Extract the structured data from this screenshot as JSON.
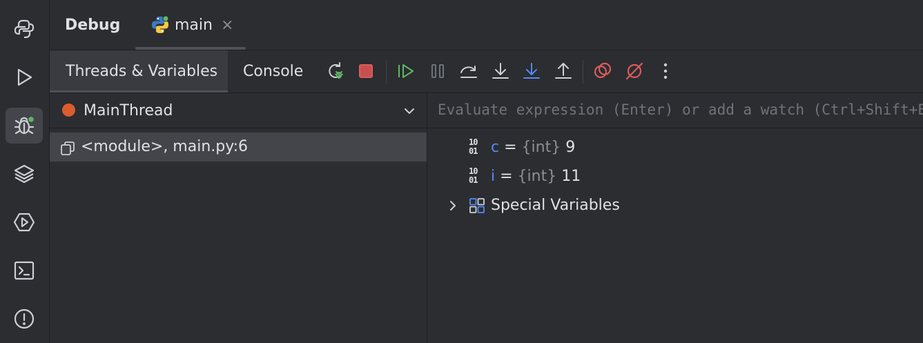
{
  "sidebar": {
    "items": [
      {
        "icon": "python-packages-icon"
      },
      {
        "icon": "run-icon"
      },
      {
        "icon": "debug-icon",
        "active": true
      },
      {
        "icon": "layers-icon"
      },
      {
        "icon": "services-icon"
      },
      {
        "icon": "terminal-icon"
      },
      {
        "icon": "problems-icon"
      }
    ]
  },
  "header": {
    "title": "Debug",
    "tab_label": "main",
    "tab_close": "×"
  },
  "toolbar": {
    "tabs": [
      "Threads & Variables",
      "Console"
    ],
    "buttons": [
      "rerun-icon",
      "stop-icon",
      "resume-icon",
      "pause-icon",
      "step-over-icon",
      "step-into-icon",
      "step-into-my-code-icon",
      "step-out-icon",
      "view-breakpoints-icon",
      "mute-breakpoints-icon",
      "more-icon"
    ]
  },
  "threads": {
    "selected": "MainThread",
    "frames": [
      {
        "label": "<module>, main.py:6"
      }
    ]
  },
  "variables": {
    "placeholder": "Evaluate expression (Enter) or add a watch (Ctrl+Shift+Enter)",
    "items": [
      {
        "name": "c",
        "eq": " = ",
        "type": "{int}",
        "value": " 9"
      },
      {
        "name": "i",
        "eq": " = ",
        "type": "{int}",
        "value": " 11"
      }
    ],
    "special": "Special Variables"
  },
  "colors": {
    "background": "#2b2d30",
    "selection": "#43454a",
    "accent_blue": "#548af7",
    "green": "#5fb865",
    "red": "#db5c5c",
    "thread_dot": "#db5c2e"
  }
}
